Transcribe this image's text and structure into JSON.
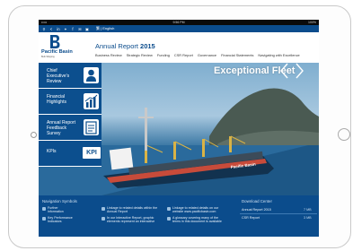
{
  "device": {
    "frame_color": "#c9c9c9"
  },
  "statusbar": {
    "left": "•••••",
    "time": "9:56 PM",
    "battery": "100%"
  },
  "toolbar": {
    "icons": [
      "search-icon",
      "share-icon",
      "linkedin-icon",
      "twitter-icon",
      "facebook-icon",
      "email-icon",
      "print-icon"
    ],
    "language": "繁 | English"
  },
  "header": {
    "logo_name": "Pacific Basin",
    "logo_tagline": "Bulk Shipping",
    "report_title_main": "Annual Report ",
    "report_title_year": "2015",
    "nav": [
      "Business Review",
      "Strategic Review",
      "Funding",
      "CSR Report",
      "Governance",
      "Financial Statements",
      "Navigating with Excellence"
    ]
  },
  "hero": {
    "title": "Exceptional Fleet",
    "ship_name": "Pacific Basin"
  },
  "tiles": [
    {
      "label": "Chief Executive's Review",
      "icon": "person-icon"
    },
    {
      "label": "Financial Highlights",
      "icon": "bar-chart-icon"
    },
    {
      "label": "Annual Report Feedback Survey",
      "icon": "survey-icon"
    },
    {
      "label": "KPIs",
      "icon": "kpi-icon",
      "badge": "KPI"
    }
  ],
  "footer": {
    "nav_heading": "Navigation Symbols",
    "symbols": [
      {
        "text1": "Further",
        "text2": "information"
      },
      {
        "text1": "Key Performance",
        "text2": "Indicators"
      },
      {
        "text1": "Linkage to related details within the",
        "text2": "Annual Report"
      },
      {
        "text1": "In our Interactive Report, graphic",
        "text2": "elements represent an interactive"
      },
      {
        "text1": "Linkage to related details on our",
        "text2": "website www.pacificbasin.com"
      },
      {
        "text1": "A glossary covering many of the",
        "text2": "terms in this document is available"
      }
    ],
    "download_heading": "Download Center",
    "downloads": [
      {
        "name": "Annual Report 2015",
        "size": "7 MB"
      },
      {
        "name": "CSR Report",
        "size": "3 MB"
      }
    ]
  },
  "colors": {
    "brand_blue": "#0b4c8c",
    "tile_blue": "#0c4f8e"
  }
}
